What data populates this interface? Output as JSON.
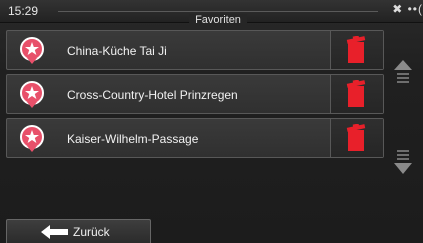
{
  "status": {
    "time": "15:29",
    "title": "Favoriten",
    "status_icons": "✖ ••("
  },
  "favorites": [
    {
      "label": "China-Küche Tai Ji",
      "icon": "poi-marker-icon",
      "delete_icon": "trash-icon"
    },
    {
      "label": "Cross-Country-Hotel Prinzregen",
      "icon": "poi-marker-icon",
      "delete_icon": "trash-icon"
    },
    {
      "label": "Kaiser-Wilhelm-Passage",
      "icon": "poi-marker-icon",
      "delete_icon": "trash-icon"
    }
  ],
  "scroll": {
    "up_icon": "scroll-up-icon",
    "down_icon": "scroll-down-icon"
  },
  "footer": {
    "back_label": "Zurück",
    "back_icon": "back-arrow-icon"
  },
  "colors": {
    "accent_red": "#e8202a",
    "poi_pink": "#e8506a",
    "row_border": "#585858"
  }
}
